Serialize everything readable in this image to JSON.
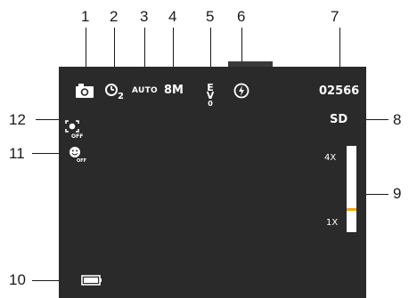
{
  "callouts": {
    "c1": "1",
    "c2": "2",
    "c3": "3",
    "c4": "4",
    "c5": "5",
    "c6": "6",
    "c7": "7",
    "c8": "8",
    "c9": "9",
    "c10": "10",
    "c11": "11",
    "c12": "12"
  },
  "osd": {
    "shot_count": "02566",
    "storage": "SD",
    "scene_mode": "AUTO",
    "resolution": "8M",
    "ev_top": "E",
    "ev_mid": "V",
    "ev_bottom": "0",
    "self_timer_sub": "2",
    "off_12": "OFF",
    "off_11": "OFF",
    "zoom_max": "4X",
    "zoom_min": "1X",
    "zoom_level_fraction": 0.25
  },
  "icons": {
    "mode": "camera-icon",
    "timer": "self-timer-icon",
    "flash": "flash-auto-icon",
    "face_detect": "face-detection-icon",
    "smile": "smile-shutter-icon",
    "battery": "battery-icon"
  },
  "colors": {
    "screen": "#2a2a2a",
    "zoom_indicator": "#f2a900",
    "osd_text": "#ffffff"
  }
}
